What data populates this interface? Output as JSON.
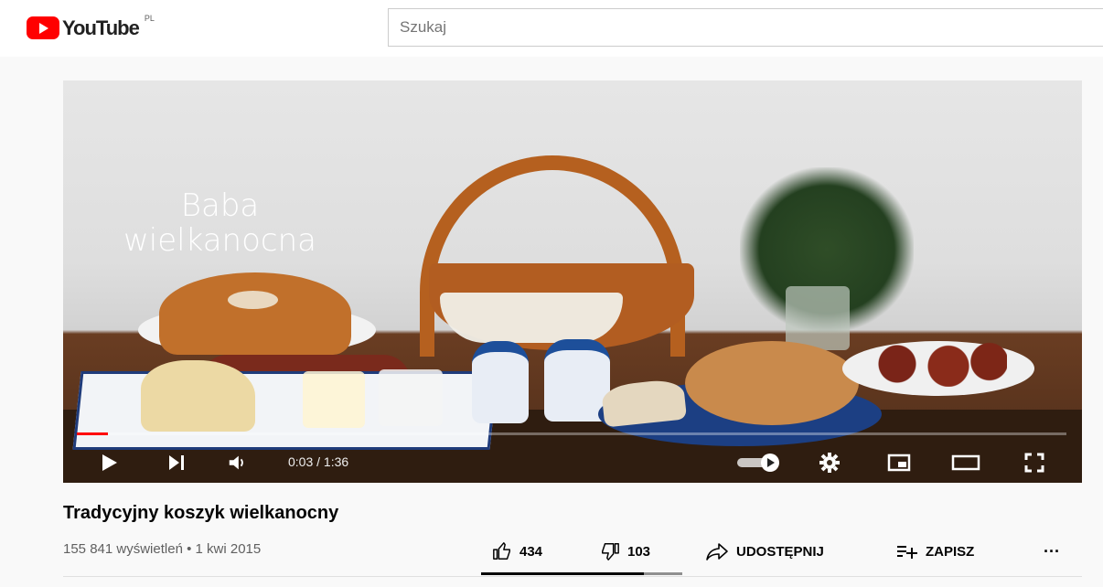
{
  "header": {
    "logo_text": "YouTube",
    "region": "PL",
    "search_placeholder": "Szukaj",
    "brand_color": "#ff0000"
  },
  "player": {
    "overlay_title_line1": "Baba",
    "overlay_title_line2": "wielkanocna",
    "time_display": "0:03 / 1:36",
    "progress_fraction": 0.031,
    "autoplay": "on"
  },
  "video": {
    "title": "Tradycyjny koszyk wielkanocny",
    "views": "155 841 wyświetleń",
    "separator": "•",
    "date": "1 kwi 2015"
  },
  "actions": {
    "likes": "434",
    "dislikes": "103",
    "share_label": "UDOSTĘPNIJ",
    "save_label": "ZAPISZ",
    "more_label": "···",
    "like_ratio": 0.808
  },
  "icons": {
    "like": "thumb-up-icon",
    "dislike": "thumb-down-icon",
    "share": "share-arrow-icon",
    "save": "playlist-add-icon",
    "more": "more-horizontal-icon"
  }
}
